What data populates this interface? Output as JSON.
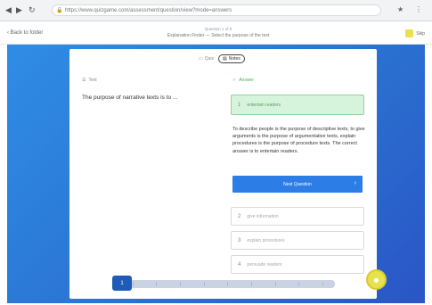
{
  "browser": {
    "back": "◀",
    "forward": "▶",
    "reload": "↻",
    "url": "https://www.quizgame.com/assessment/question/view?mode=answers",
    "ext1": "★",
    "ext2": "⋮"
  },
  "header": {
    "back_link": "‹ Back to folder",
    "sub": "Question 1 of 8",
    "title": "Explanation Finder — Select the purpose of the text",
    "right_label": "Skip"
  },
  "toggle": {
    "opt1_icon": "▭",
    "opt1": "Quiz",
    "opt2_icon": "▤",
    "opt2": "Notes"
  },
  "question": {
    "label_icon": "☰",
    "label": "Text",
    "text": "The purpose of narrative texts is to ..."
  },
  "answer": {
    "label_icon": "✓",
    "label": "Answer",
    "options": [
      {
        "num": "1",
        "text": "entertain readers"
      },
      {
        "num": "2",
        "text": "give information"
      },
      {
        "num": "3",
        "text": "explain procedures"
      },
      {
        "num": "4",
        "text": "persuade readers"
      }
    ],
    "explanation": "To describe people is the purpose of descriptive texts, to give arguments is the purpose of argumentative texts, explain procedures is the purpose of procedure texts. The correct answer is to entertain readers.",
    "button": "Next Question",
    "button_arrow": "›"
  },
  "progress": {
    "current": "1",
    "total_steps": 9
  },
  "fab": "☻"
}
